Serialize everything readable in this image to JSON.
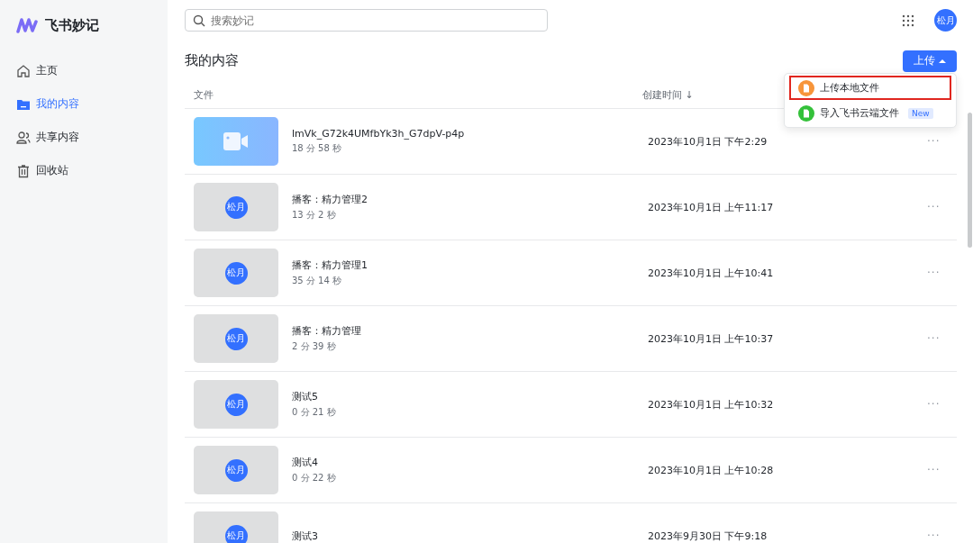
{
  "app": {
    "name": "飞书妙记"
  },
  "sidebar": {
    "items": [
      {
        "label": "主页",
        "selected": false
      },
      {
        "label": "我的内容",
        "selected": true
      },
      {
        "label": "共享内容",
        "selected": false
      },
      {
        "label": "回收站",
        "selected": false
      }
    ]
  },
  "search": {
    "placeholder": "搜索妙记"
  },
  "user": {
    "avatar": "松月"
  },
  "page_title": "我的内容",
  "upload_button": {
    "label": "上传",
    "expanded": true
  },
  "upload_menu": [
    {
      "label": "上传本地文件",
      "color": "#f7953a",
      "highlighted": true
    },
    {
      "label": "导入飞书云端文件",
      "color": "#34c13a",
      "highlighted": false,
      "badge": "New"
    }
  ],
  "table": {
    "columns": [
      "文件",
      "创建时间 ↓"
    ],
    "rows": [
      {
        "kind": "video",
        "name": "lmVk_G72k4UMfbYk3h_G7dpV-p4p",
        "duration": "18 分 58 秒",
        "created": "2023年10月1日 下午2:29",
        "more": "···"
      },
      {
        "kind": "avatar",
        "thumb": "松月",
        "name": "播客：精力管理2",
        "duration": "13 分 2 秒",
        "created": "2023年10月1日 上午11:17",
        "more": "···"
      },
      {
        "kind": "avatar",
        "thumb": "松月",
        "name": "播客：精力管理1",
        "duration": "35 分 14 秒",
        "created": "2023年10月1日 上午10:41",
        "more": "···"
      },
      {
        "kind": "avatar",
        "thumb": "松月",
        "name": "播客：精力管理",
        "duration": "2 分 39 秒",
        "created": "2023年10月1日 上午10:37",
        "more": "···"
      },
      {
        "kind": "avatar",
        "thumb": "松月",
        "name": "测试5",
        "duration": "0 分 21 秒",
        "created": "2023年10月1日 上午10:32",
        "more": "···"
      },
      {
        "kind": "avatar",
        "thumb": "松月",
        "name": "测试4",
        "duration": "0 分 22 秒",
        "created": "2023年10月1日 上午10:28",
        "more": "···"
      },
      {
        "kind": "avatar",
        "thumb": "松月",
        "name": "测试3",
        "created": "2023年9月30日 下午9:18",
        "more": "···"
      }
    ]
  }
}
